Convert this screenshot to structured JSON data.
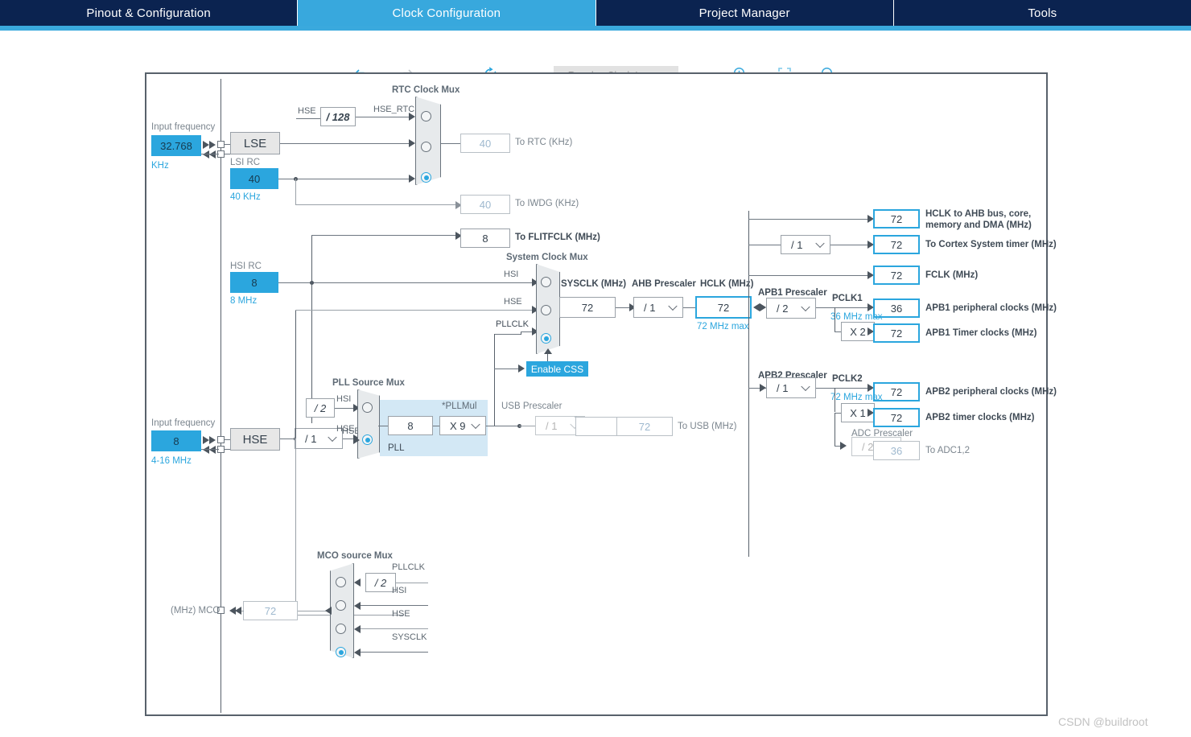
{
  "tabs": [
    {
      "label": "Pinout & Configuration",
      "active": false
    },
    {
      "label": "Clock Configuration",
      "active": true
    },
    {
      "label": "Project Manager",
      "active": false
    },
    {
      "label": "Tools",
      "active": false
    }
  ],
  "toolbar": {
    "undo": "undo-icon",
    "redo": "redo-icon",
    "reset": "reset-icon",
    "resolve_label": "Resolve Clock Issues",
    "zoom_in": "zoom-in-icon",
    "fit": "fit-to-screen-icon",
    "zoom_out": "zoom-out-icon"
  },
  "colors": {
    "accent": "#2ba6de",
    "tabbar": "#0b2350",
    "active_tab": "#38a8dd",
    "canvas_border": "#58616b",
    "pll_bg": "#d3e8f5"
  },
  "diagram": {
    "lse": {
      "input_freq_label": "Input frequency",
      "value": "32.768",
      "unit": "KHz",
      "source_label": "LSE"
    },
    "lsi": {
      "title": "LSI RC",
      "value": "40",
      "unit": "40 KHz"
    },
    "hsi": {
      "title": "HSI RC",
      "value": "8",
      "unit": "8 MHz"
    },
    "hse": {
      "input_freq_label": "Input frequency",
      "value": "8",
      "unit": "4-16 MHz",
      "source_label": "HSE",
      "divider": "/ 1",
      "signal": "HSE"
    },
    "hse_rtc_div": {
      "label": "/ 128",
      "in_signal": "HSE",
      "out_signal": "HSE_RTC"
    },
    "rtc_mux": {
      "title": "RTC Clock Mux",
      "inputs": [
        "HSE_RTC",
        "LSE",
        "LSI"
      ],
      "selected": 2
    },
    "to_rtc": {
      "value": "40",
      "label": "To RTC (KHz)"
    },
    "to_iwdg": {
      "value": "40",
      "label": "To IWDG (KHz)"
    },
    "to_flitfclk": {
      "value": "8",
      "label": "To FLITFCLK (MHz)"
    },
    "sysclk_mux": {
      "title": "System Clock Mux",
      "inputs": [
        "HSI",
        "HSE",
        "PLLCLK"
      ],
      "selected": 2
    },
    "enable_css": "Enable CSS",
    "sysclk": {
      "label": "SYSCLK (MHz)",
      "value": "72"
    },
    "ahb_prescaler": {
      "label": "AHB Prescaler",
      "value": "/ 1"
    },
    "hclk": {
      "label": "HCLK (MHz)",
      "value": "72",
      "note": "72 MHz max"
    },
    "pll_source_mux": {
      "title": "PLL Source Mux",
      "inputs": [
        "HSI",
        "HSE"
      ],
      "selected": 1,
      "hsi_div": "/ 2"
    },
    "pll": {
      "block_label": "PLL",
      "input_value": "8",
      "mul_label": "*PLLMul",
      "mul_value": "X 9"
    },
    "usb_prescaler": {
      "label": "USB Prescaler",
      "value": "/ 1"
    },
    "to_usb": {
      "value": "72",
      "label": "To USB (MHz)"
    },
    "hclk_outputs": [
      {
        "value": "72",
        "label": "HCLK to AHB bus, core,",
        "label2": "memory and DMA (MHz)"
      },
      {
        "value": "72",
        "label": "To Cortex System timer (MHz)",
        "prescaler": "/ 1"
      },
      {
        "value": "72",
        "label": "FCLK (MHz)"
      }
    ],
    "apb1": {
      "prescaler_label": "APB1 Prescaler",
      "prescaler_value": "/ 2",
      "pclk_label": "PCLK1",
      "note": "36 MHz max",
      "periph": {
        "value": "36",
        "label": "APB1 peripheral clocks (MHz)"
      },
      "timer_mul": "X 2",
      "timer": {
        "value": "72",
        "label": "APB1 Timer clocks (MHz)"
      }
    },
    "apb2": {
      "prescaler_label": "APB2 Prescaler",
      "prescaler_value": "/ 1",
      "pclk_label": "PCLK2",
      "note": "72 MHz max",
      "periph": {
        "value": "72",
        "label": "APB2 peripheral clocks (MHz)"
      },
      "timer_mul": "X 1",
      "timer": {
        "value": "72",
        "label": "APB2 timer clocks (MHz)"
      },
      "adc_prescaler_label": "ADC Prescaler",
      "adc_prescaler_value": "/ 2",
      "adc": {
        "value": "36",
        "label": "To ADC1,2"
      }
    },
    "mco": {
      "title": "MCO source Mux",
      "out_label": "(MHz) MCO",
      "value": "72",
      "pllclk_div": "/ 2",
      "inputs": [
        "PLLCLK",
        "HSI",
        "HSE",
        "SYSCLK"
      ],
      "selected": 3
    }
  },
  "watermark": "CSDN @buildroot"
}
